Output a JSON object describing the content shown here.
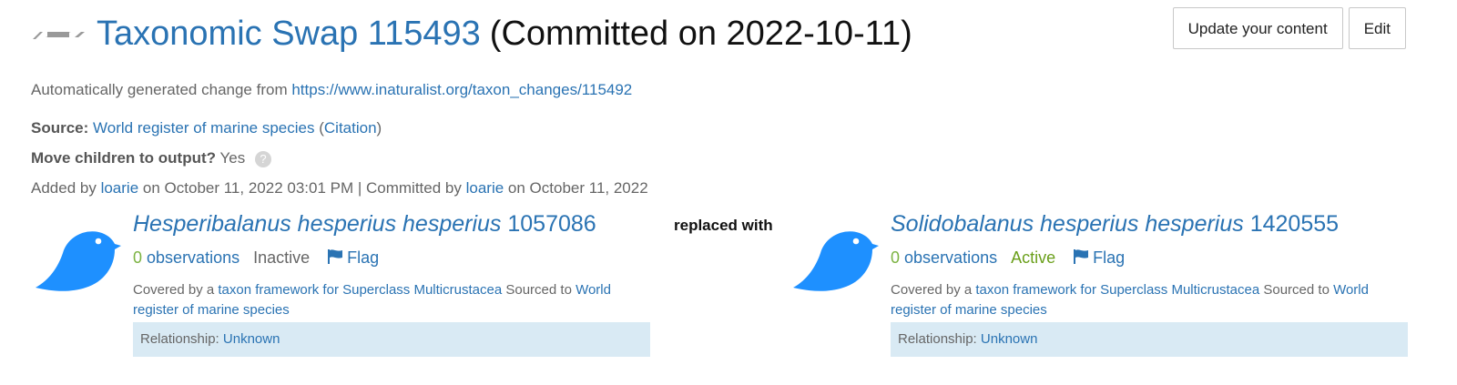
{
  "header": {
    "swap_icon": "swap-dashes-icon",
    "taxon_change_name": "Taxonomic Swap 115493",
    "committed_text": "(Committed on 2022-10-11)",
    "buttons": {
      "update": "Update your content",
      "edit": "Edit"
    }
  },
  "description": {
    "prefix": "Automatically generated change from",
    "url": "https://www.inaturalist.org/taxon_changes/115492"
  },
  "source": {
    "label": "Source:",
    "name": "World register of marine species",
    "open_paren": "(",
    "citation": "Citation",
    "close_paren": ")"
  },
  "move_children": {
    "label": "Move children to output?",
    "value": "Yes",
    "help_icon": "question-circle-icon"
  },
  "added": {
    "added_by_text": "Added by",
    "added_user": "loarie",
    "added_date_text": "on October 11, 2022 03:01 PM | Committed by",
    "committed_user": "loarie",
    "committed_date_text": "on October 11, 2022"
  },
  "replaced_with": "replaced with",
  "taxa": [
    {
      "icon": "bird-icon",
      "name": "Hesperibalanus hesperius hesperius",
      "id": "1057086",
      "obs_count": "0",
      "obs_label": "observations",
      "status": "Inactive",
      "flag_label": "Flag",
      "covered_prefix": "Covered by a",
      "framework_link": "taxon framework for Superclass Multicrustacea",
      "sourced_text": "Sourced to",
      "source_link": "World register of marine species",
      "relationship_label": "Relationship:",
      "relationship_value": "Unknown"
    },
    {
      "icon": "bird-icon",
      "name": "Solidobalanus hesperius hesperius",
      "id": "1420555",
      "obs_count": "0",
      "obs_label": "observations",
      "status": "Active",
      "flag_label": "Flag",
      "covered_prefix": "Covered by a",
      "framework_link": "taxon framework for Superclass Multicrustacea",
      "sourced_text": "Sourced to",
      "source_link": "World register of marine species",
      "relationship_label": "Relationship:",
      "relationship_value": "Unknown"
    }
  ],
  "colors": {
    "link": "#2a73b3",
    "bird": "#1e90ff",
    "active": "#6a9f1a",
    "relationship_bg": "#d9eaf4"
  }
}
